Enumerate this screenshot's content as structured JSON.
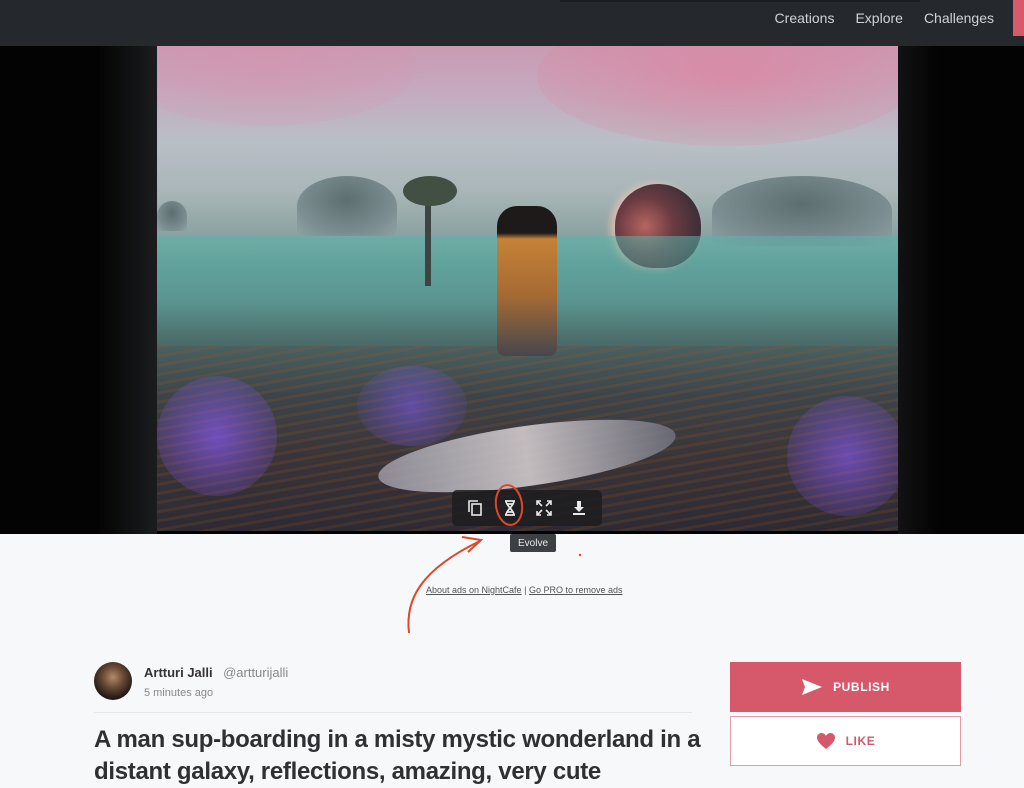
{
  "header": {
    "nav": [
      "Creations",
      "Explore",
      "Challenges"
    ],
    "accent_color": "#d75a6b"
  },
  "image_toolbar": {
    "tools": [
      {
        "icon": "copy-icon",
        "label": "Duplicate"
      },
      {
        "icon": "dna-evolve-icon",
        "label": "Evolve"
      },
      {
        "icon": "fullscreen-icon",
        "label": "Fullscreen"
      },
      {
        "icon": "download-icon",
        "label": "Download"
      }
    ],
    "tooltip": "Evolve"
  },
  "ads": {
    "about_link": "About ads on NightCafe",
    "separator": "|",
    "pro_link": "Go PRO to remove ads"
  },
  "post": {
    "author_name": "Artturi Jalli",
    "author_handle": "@artturijalli",
    "time": "5 minutes ago",
    "title": "A man sup-boarding in a misty mystic wonderland in a distant galaxy, reflections, amazing, very cute"
  },
  "actions": {
    "publish_label": "PUBLISH",
    "like_label": "LIKE",
    "brand_color": "#d5596b"
  }
}
